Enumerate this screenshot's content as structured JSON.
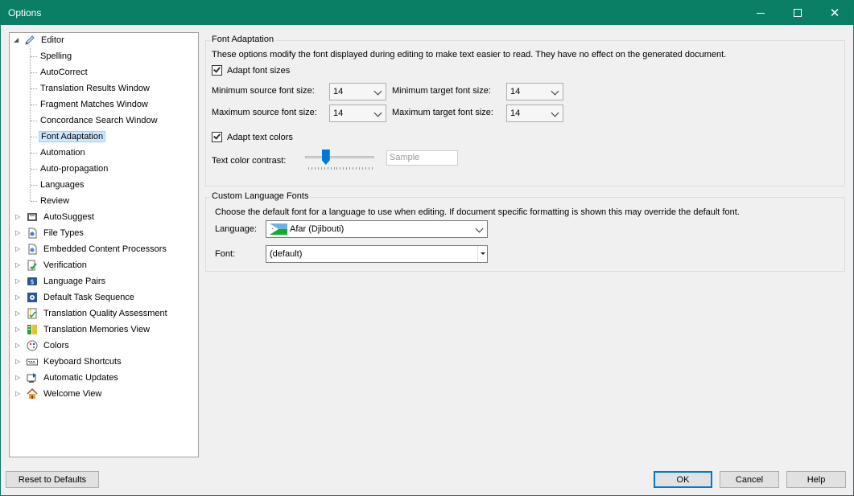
{
  "window": {
    "title": "Options",
    "accent_color": "#0a7f66"
  },
  "tree": {
    "editor": {
      "label": "Editor",
      "icon": "pencil-icon",
      "expanded": true
    },
    "editor_children": [
      {
        "label": "Spelling"
      },
      {
        "label": "AutoCorrect"
      },
      {
        "label": "Translation Results Window"
      },
      {
        "label": "Fragment Matches Window"
      },
      {
        "label": "Concordance Search Window"
      },
      {
        "label": "Font Adaptation",
        "selected": true
      },
      {
        "label": "Automation"
      },
      {
        "label": "Auto-propagation"
      },
      {
        "label": "Languages"
      },
      {
        "label": "Review"
      }
    ],
    "top_items": [
      {
        "label": "AutoSuggest",
        "icon": "autosuggest-icon"
      },
      {
        "label": "File Types",
        "icon": "file-types-icon"
      },
      {
        "label": "Embedded Content Processors",
        "icon": "embedded-content-icon"
      },
      {
        "label": "Verification",
        "icon": "verification-icon"
      },
      {
        "label": "Language Pairs",
        "icon": "language-pairs-icon"
      },
      {
        "label": "Default Task Sequence",
        "icon": "task-sequence-icon"
      },
      {
        "label": "Translation Quality Assessment",
        "icon": "quality-assessment-icon"
      },
      {
        "label": "Translation Memories View",
        "icon": "translation-memories-icon"
      },
      {
        "label": "Colors",
        "icon": "palette-icon"
      },
      {
        "label": "Keyboard Shortcuts",
        "icon": "keyboard-icon"
      },
      {
        "label": "Automatic Updates",
        "icon": "updates-icon"
      },
      {
        "label": "Welcome View",
        "icon": "home-icon"
      }
    ]
  },
  "font_adaptation": {
    "group_title": "Font Adaptation",
    "description": "These options modify the font displayed during editing to make text easier to read. They have no effect on the generated document.",
    "adapt_font_sizes_label": "Adapt font sizes",
    "adapt_font_sizes_checked": true,
    "min_source_label": "Minimum source font size:",
    "min_source_value": "14",
    "min_target_label": "Minimum target font size:",
    "min_target_value": "14",
    "max_source_label": "Maximum source font size:",
    "max_source_value": "14",
    "max_target_label": "Maximum target font size:",
    "max_target_value": "14",
    "adapt_text_colors_label": "Adapt text colors",
    "adapt_text_colors_checked": true,
    "contrast_label": "Text color contrast:",
    "contrast_level": 0.3,
    "sample_text": "Sample"
  },
  "custom_fonts": {
    "group_title": "Custom Language Fonts",
    "description": "Choose the default font for a language to use when editing. If document specific formatting is shown this may override the default font.",
    "language_label": "Language:",
    "language_value": "Afar (Djibouti)",
    "font_label": "Font:",
    "font_value": "(default)"
  },
  "buttons": {
    "reset": "Reset to Defaults",
    "ok": "OK",
    "cancel": "Cancel",
    "help": "Help"
  }
}
